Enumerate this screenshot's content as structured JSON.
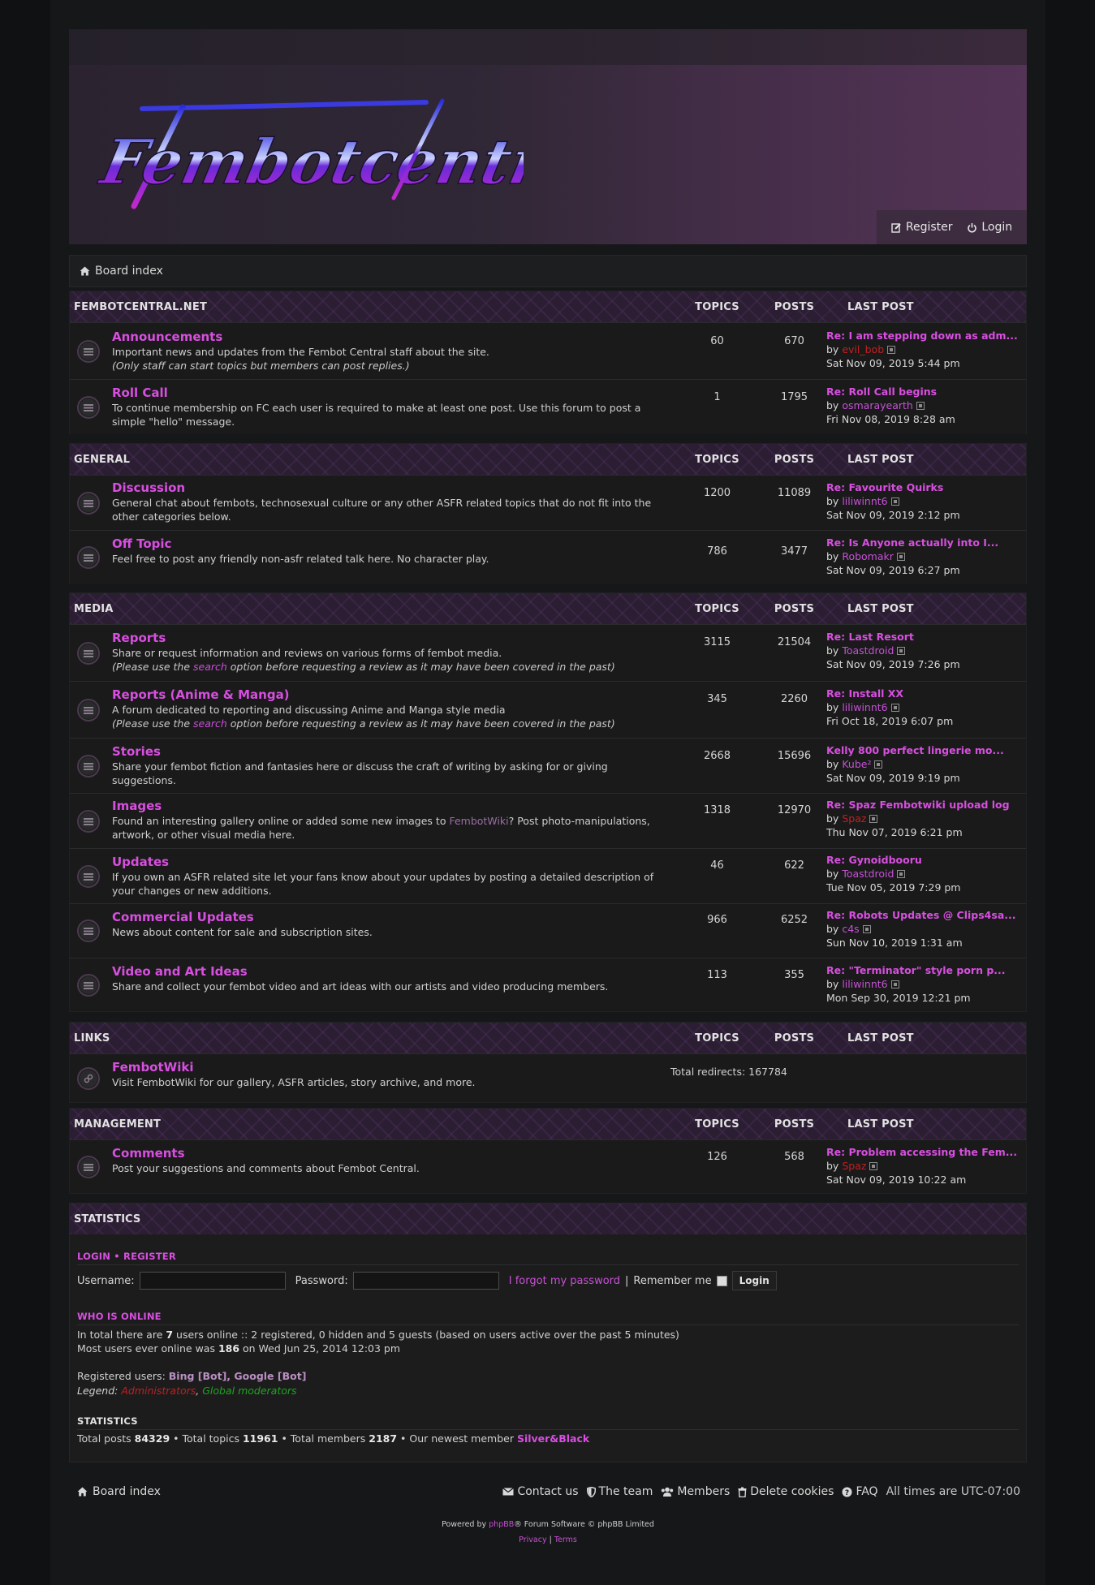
{
  "site": {
    "logo_text": "Fembotcentral",
    "register_label": "Register",
    "login_label": "Login"
  },
  "breadcrumb": {
    "label": "Board index"
  },
  "columns": {
    "topics": "TOPICS",
    "posts": "POSTS",
    "last_post": "LAST POST"
  },
  "categories": [
    {
      "name": "FEMBOTCENTRAL.NET",
      "forums": [
        {
          "title": "Announcements",
          "desc": "Important news and updates from the Fembot Central staff about the site.",
          "note": "(Only staff can start topics but members can post replies.)",
          "topics": "60",
          "posts": "670",
          "last_title": "Re: I am stepping down as adm...",
          "last_by": "by",
          "last_user": "evil_bob",
          "last_date": "Sat Nov 09, 2019 5:44 pm"
        },
        {
          "title": "Roll Call",
          "desc": "To continue membership on FC each user is required to make at least one post. Use this forum to post a simple \"hello\" message.",
          "topics": "1",
          "posts": "1795",
          "last_title": "Re: Roll Call begins",
          "last_by": "by",
          "last_user": "osmarayearth",
          "last_date": "Fri Nov 08, 2019 8:28 am"
        }
      ]
    },
    {
      "name": "GENERAL",
      "forums": [
        {
          "title": "Discussion",
          "desc": "General chat about fembots, technosexual culture or any other ASFR related topics that do not fit into the other categories below.",
          "topics": "1200",
          "posts": "11089",
          "last_title": "Re: Favourite Quirks",
          "last_by": "by",
          "last_user": "liliwinnt6",
          "last_date": "Sat Nov 09, 2019 2:12 pm"
        },
        {
          "title": "Off Topic",
          "desc": "Feel free to post any friendly non-asfr related talk here. No character play.",
          "topics": "786",
          "posts": "3477",
          "last_title": "Re: Is Anyone actually into I...",
          "last_by": "by",
          "last_user": "Robomakr",
          "last_date": "Sat Nov 09, 2019 6:27 pm"
        }
      ]
    },
    {
      "name": "MEDIA",
      "forums": [
        {
          "title": "Reports",
          "desc": "Share or request information and reviews on various forms of fembot media.",
          "note_pre": "(Please use the ",
          "note_link": "search",
          "note_post": " option before requesting a review as it may have been covered in the past)",
          "topics": "3115",
          "posts": "21504",
          "last_title": "Re: Last Resort",
          "last_by": "by",
          "last_user": "Toastdroid",
          "last_date": "Sat Nov 09, 2019 7:26 pm"
        },
        {
          "title": "Reports (Anime & Manga)",
          "desc": "A forum dedicated to reporting and discussing Anime and Manga style media",
          "note_pre": "(Please use the ",
          "note_link": "search",
          "note_post": " option before requesting a review as it may have been covered in the past)",
          "topics": "345",
          "posts": "2260",
          "last_title": "Re: Install XX",
          "last_by": "by",
          "last_user": "liliwinnt6",
          "last_date": "Fri Oct 18, 2019 6:07 pm"
        },
        {
          "title": "Stories",
          "desc": "Share your fembot fiction and fantasies here or discuss the craft of writing by asking for or giving suggestions.",
          "topics": "2668",
          "posts": "15696",
          "last_title": "Kelly 800 perfect lingerie mo...",
          "last_by": "by",
          "last_user": "Kube²",
          "last_date": "Sat Nov 09, 2019 9:19 pm"
        },
        {
          "title": "Images",
          "desc_pre": "Found an interesting gallery online or added some new images to ",
          "desc_link": "FembotWiki",
          "desc_post": "? Post photo-manipulations, artwork, or other visual media here.",
          "topics": "1318",
          "posts": "12970",
          "last_title": "Re: Spaz Fembotwiki upload log",
          "last_by": "by",
          "last_user": "Spaz",
          "last_date": "Thu Nov 07, 2019 6:21 pm"
        },
        {
          "title": "Updates",
          "desc": "If you own an ASFR related site let your fans know about your updates by posting a detailed description of your changes or new additions.",
          "topics": "46",
          "posts": "622",
          "last_title": "Re: Gynoidbooru",
          "last_by": "by",
          "last_user": "Toastdroid",
          "last_date": "Tue Nov 05, 2019 7:29 pm"
        },
        {
          "title": "Commercial Updates",
          "desc": "News about content for sale and subscription sites.",
          "topics": "966",
          "posts": "6252",
          "last_title": "Re: Robots Updates @ Clips4sa...",
          "last_by": "by",
          "last_user": "c4s",
          "last_date": "Sun Nov 10, 2019 1:31 am"
        },
        {
          "title": "Video and Art Ideas",
          "desc": "Share and collect your fembot video and art ideas with our artists and video producing members.",
          "topics": "113",
          "posts": "355",
          "last_title": "Re: \"Terminator\" style porn p...",
          "last_by": "by",
          "last_user": "liliwinnt6",
          "last_date": "Mon Sep 30, 2019 12:21 pm"
        }
      ]
    },
    {
      "name": "LINKS",
      "forums": [
        {
          "title": "FembotWiki",
          "desc": "Visit FembotWiki for our gallery, ASFR articles, story archive, and more.",
          "redirects": "Total redirects: 167784"
        }
      ]
    },
    {
      "name": "MANAGEMENT",
      "forums": [
        {
          "title": "Comments",
          "desc": "Post your suggestions and comments about Fembot Central.",
          "topics": "126",
          "posts": "568",
          "last_title": "Re: Problem accessing the Fem...",
          "last_by": "by",
          "last_user": "Spaz",
          "last_date": "Sat Nov 09, 2019 10:22 am"
        }
      ]
    }
  ],
  "statistics": {
    "title": "STATISTICS",
    "login_link": "LOGIN",
    "sep": "•",
    "register_link": "REGISTER",
    "username_label": "Username:",
    "password_label": "Password:",
    "forgot": "I forgot my password",
    "pipe": "|",
    "remember": "Remember me",
    "login_button": "Login",
    "who_title": "WHO IS ONLINE",
    "online_pre": "In total there are ",
    "online_count": "7",
    "online_post": " users online :: 2 registered, 0 hidden and 5 guests (based on users active over the past 5 minutes)",
    "most_pre": "Most users ever online was ",
    "most_count": "186",
    "most_post": " on Wed Jun 25, 2014 12:03 pm",
    "registered_label": "Registered users: ",
    "registered_users": "Bing [Bot], Google [Bot]",
    "legend_label": "Legend: ",
    "legend_admin": "Administrators",
    "legend_comma": ", ",
    "legend_gm": "Global moderators",
    "stats_title": "STATISTICS",
    "tp_pre": "Total posts ",
    "total_posts": "84329",
    "tt_pre": " • Total topics ",
    "total_topics": "11961",
    "tm_pre": " • Total members ",
    "total_members": "2187",
    "nm_pre": " • Our newest member ",
    "newest_member": "Silver&Black"
  },
  "footer": {
    "board_index": "Board index",
    "contact": "Contact us",
    "team": "The team",
    "members": "Members",
    "delete_cookies": "Delete cookies",
    "faq": "FAQ",
    "timezone": "All times are UTC-07:00",
    "powered_pre": "Powered by ",
    "powered_link": "phpBB",
    "powered_post": "® Forum Software © phpBB Limited",
    "privacy": "Privacy",
    "pipe": "|",
    "terms": "Terms"
  },
  "colors": {
    "accent": "#d84fe0",
    "admin": "#c02020",
    "global_mod": "#1fa51f",
    "bg": "#161718"
  }
}
